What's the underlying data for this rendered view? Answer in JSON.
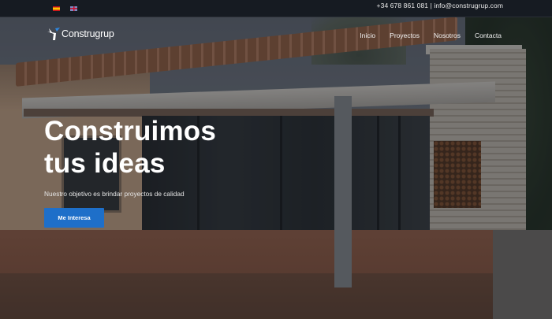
{
  "topbar": {
    "languages": [
      {
        "code": "es",
        "icon": "spanish-flag-icon"
      },
      {
        "code": "en",
        "icon": "uk-flag-icon"
      }
    ],
    "phone": "+34 678 861 081",
    "separator": "|",
    "email": "info@construgrup.com"
  },
  "header": {
    "logo_text": "Construgrup",
    "menu": [
      {
        "label": "Inicio"
      },
      {
        "label": "Proyectos"
      },
      {
        "label": "Nosotros"
      },
      {
        "label": "Contacta"
      }
    ]
  },
  "hero": {
    "title_line1": "Construimos",
    "title_line2": "tus ideas",
    "subtitle": "Nuestro objetivo es brindar proyectos de calidad",
    "cta_label": "Me Interesa",
    "cta_color": "#1e6fc9"
  }
}
